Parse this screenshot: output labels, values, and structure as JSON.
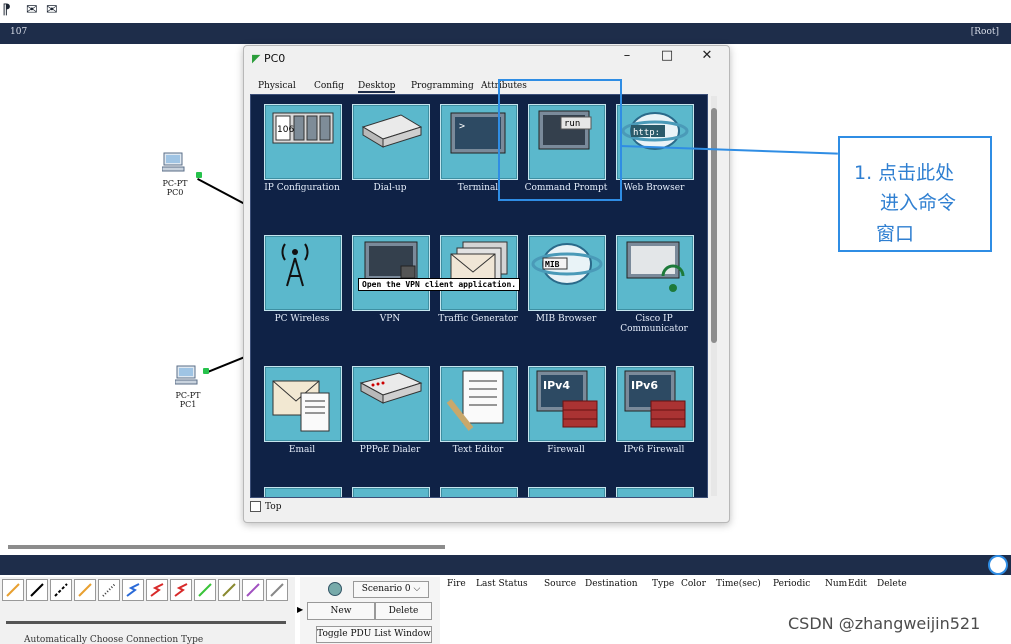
{
  "toolbar": {
    "icons": [
      "pen-icon",
      "mail-icon",
      "open-mail-icon"
    ]
  },
  "navbar": {
    "left_text": "107",
    "right_text": "[Root]"
  },
  "devices": [
    {
      "type": "PC-PT",
      "name": "PC0"
    },
    {
      "type": "PC-PT",
      "name": "PC1"
    }
  ],
  "window": {
    "title": "PC0",
    "controls": {
      "minimize": "–",
      "maximize": "□",
      "close": "✕"
    },
    "tabs": [
      "Physical",
      "Config",
      "Desktop",
      "Programming",
      "Attributes"
    ],
    "active_tab": "Desktop",
    "apps": [
      {
        "label": "IP Configuration",
        "icon": "ip-config-icon"
      },
      {
        "label": "Dial-up",
        "icon": "modem-icon"
      },
      {
        "label": "Terminal",
        "icon": "terminal-icon"
      },
      {
        "label": "Command Prompt",
        "icon": "command-prompt-icon",
        "badge": "run"
      },
      {
        "label": "Web Browser",
        "icon": "web-browser-icon",
        "badge": "http:"
      },
      {
        "label": "PC Wireless",
        "icon": "wireless-icon"
      },
      {
        "label": "VPN",
        "icon": "vpn-icon"
      },
      {
        "label": "Traffic Generator",
        "icon": "traffic-generator-icon"
      },
      {
        "label": "MIB Browser",
        "icon": "mib-browser-icon",
        "badge": "MIB"
      },
      {
        "label": "Cisco IP Communicator",
        "icon": "ip-communicator-icon"
      },
      {
        "label": "Email",
        "icon": "email-icon"
      },
      {
        "label": "PPPoE Dialer",
        "icon": "pppoe-icon"
      },
      {
        "label": "Text Editor",
        "icon": "text-editor-icon"
      },
      {
        "label": "Firewall",
        "icon": "firewall-icon",
        "badge": "IPv4"
      },
      {
        "label": "IPv6 Firewall",
        "icon": "ipv6-firewall-icon",
        "badge": "IPv6"
      }
    ],
    "tooltip": "Open the VPN client application.",
    "top_checkbox": {
      "label": "Top",
      "checked": false
    }
  },
  "annotation": {
    "lines": [
      "1. 点击此处",
      "进入命令",
      "窗口"
    ],
    "color": "#2f8de4"
  },
  "bottom": {
    "scenario_select": "Scenario 0",
    "new_button": "New",
    "delete_button": "Delete",
    "toggle_button": "Toggle PDU List Window",
    "columns": [
      "Fire",
      "Last Status",
      "Source",
      "Destination",
      "Type",
      "Color",
      "Time(sec)",
      "Periodic",
      "Num",
      "Edit",
      "Delete"
    ],
    "cut_text": "Automatically Choose Connection Type"
  },
  "watermark": "CSDN @zhangweijin521"
}
